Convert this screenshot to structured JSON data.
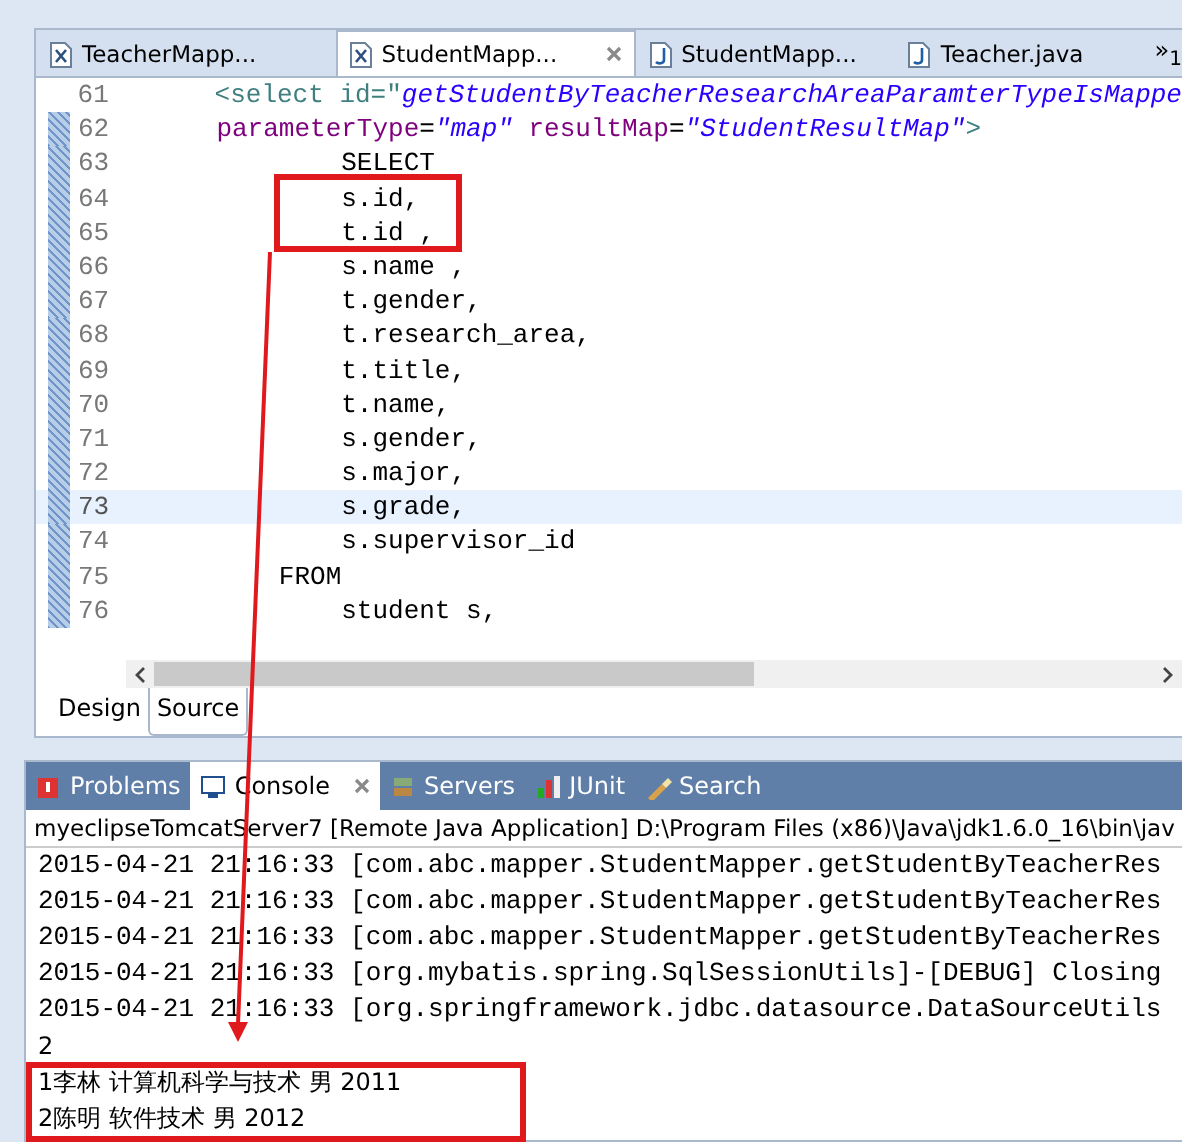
{
  "editor_tabs": [
    {
      "label": "TeacherMapp...",
      "kind": "xml",
      "selected": false
    },
    {
      "label": "StudentMapp...",
      "kind": "xml",
      "selected": true
    },
    {
      "label": "StudentMapp...",
      "kind": "java",
      "selected": false
    },
    {
      "label": "Teacher.java",
      "kind": "java",
      "selected": false
    }
  ],
  "overflow": {
    "symbol": "»",
    "count": "1"
  },
  "code_lines": [
    {
      "number": "61",
      "current": false,
      "segments": [
        {
          "text": "    <select id=\"",
          "kind": "tag"
        },
        {
          "text": "getStudentByTeacherResearchAreaParamterTypeIsMappe",
          "kind": "string"
        }
      ]
    },
    {
      "number": "62",
      "current": false,
      "segments": [
        {
          "text": "    parameterType",
          "kind": "attr"
        },
        {
          "text": "=",
          "kind": "plain"
        },
        {
          "text": "\"map\"",
          "kind": "string"
        },
        {
          "text": " resultMap",
          "kind": "attr"
        },
        {
          "text": "=",
          "kind": "plain"
        },
        {
          "text": "\"StudentResultMap\"",
          "kind": "string"
        },
        {
          "text": ">",
          "kind": "tag"
        }
      ]
    },
    {
      "number": "63",
      "current": false,
      "segments": [
        {
          "text": "            SELECT",
          "kind": "plain"
        }
      ]
    },
    {
      "number": "64",
      "current": false,
      "segments": [
        {
          "text": "            s.id,",
          "kind": "plain"
        }
      ]
    },
    {
      "number": "65",
      "current": false,
      "segments": [
        {
          "text": "            t.id ,",
          "kind": "plain"
        }
      ]
    },
    {
      "number": "66",
      "current": false,
      "segments": [
        {
          "text": "            s.name ,",
          "kind": "plain"
        }
      ]
    },
    {
      "number": "67",
      "current": false,
      "segments": [
        {
          "text": "            t.gender,",
          "kind": "plain"
        }
      ]
    },
    {
      "number": "68",
      "current": false,
      "segments": [
        {
          "text": "            t.research_area,",
          "kind": "plain"
        }
      ]
    },
    {
      "number": "69",
      "current": false,
      "segments": [
        {
          "text": "            t.title,",
          "kind": "plain"
        }
      ]
    },
    {
      "number": "70",
      "current": false,
      "segments": [
        {
          "text": "            t.name,",
          "kind": "plain"
        }
      ]
    },
    {
      "number": "71",
      "current": false,
      "segments": [
        {
          "text": "            s.gender,",
          "kind": "plain"
        }
      ]
    },
    {
      "number": "72",
      "current": false,
      "segments": [
        {
          "text": "            s.major,",
          "kind": "plain"
        }
      ]
    },
    {
      "number": "73",
      "current": true,
      "segments": [
        {
          "text": "            s.grade,",
          "kind": "plain"
        }
      ]
    },
    {
      "number": "74",
      "current": false,
      "segments": [
        {
          "text": "            s.supervisor_id",
          "kind": "plain"
        }
      ]
    },
    {
      "number": "75",
      "current": false,
      "segments": [
        {
          "text": "        FROM",
          "kind": "plain"
        }
      ]
    },
    {
      "number": "76",
      "current": false,
      "segments": [
        {
          "text": "            student s,",
          "kind": "plain"
        }
      ]
    }
  ],
  "view_tabs": [
    {
      "label": "Design",
      "selected": false
    },
    {
      "label": "Source",
      "selected": true
    }
  ],
  "panel_tabs": [
    {
      "label": "Problems",
      "kind": "problems",
      "selected": false
    },
    {
      "label": "Console",
      "kind": "console",
      "selected": true
    },
    {
      "label": "Servers",
      "kind": "servers",
      "selected": false
    },
    {
      "label": "JUnit",
      "kind": "junit",
      "selected": false
    },
    {
      "label": "Search",
      "kind": "search",
      "selected": false
    }
  ],
  "console": {
    "header": "myeclipseTomcatServer7 [Remote Java Application] D:\\Program Files (x86)\\Java\\jdk1.6.0_16\\bin\\jav",
    "log_lines": [
      "2015-04-21 21:16:33 [com.abc.mapper.StudentMapper.getStudentByTeacherRes",
      "2015-04-21 21:16:33 [com.abc.mapper.StudentMapper.getStudentByTeacherRes",
      "2015-04-21 21:16:33 [com.abc.mapper.StudentMapper.getStudentByTeacherRes",
      "2015-04-21 21:16:33 [org.mybatis.spring.SqlSessionUtils]-[DEBUG] Closing",
      "2015-04-21 21:16:33 [org.springframework.jdbc.datasource.DataSourceUtils"
    ],
    "output_lines": [
      "2",
      "1李林 计算机科学与技术 男 2011",
      "2陈明 软件技术 男 2012"
    ]
  }
}
